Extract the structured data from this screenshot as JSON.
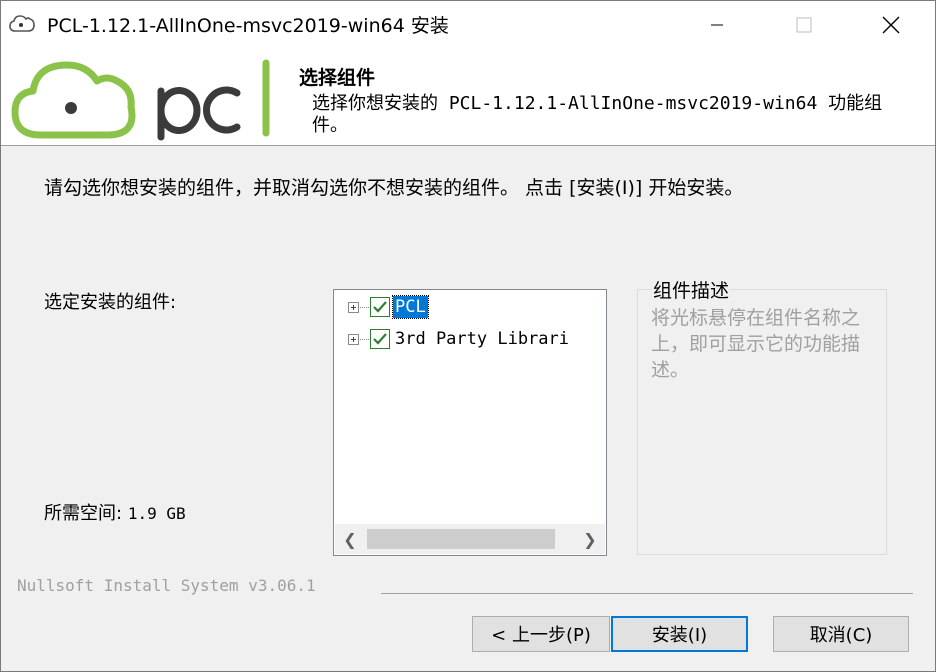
{
  "window": {
    "title": "PCL-1.12.1-AllInOne-msvc2019-win64 安装"
  },
  "header": {
    "title": "选择组件",
    "description": "选择你想安装的 PCL-1.12.1-AllInOne-msvc2019-win64 功能组件。"
  },
  "intro": "请勾选你想安装的组件，并取消勾选你不想安装的组件。 点击 [安装(I)] 开始安装。",
  "components": {
    "label": "选定安装的组件:",
    "items": [
      {
        "label": "PCL",
        "checked": true,
        "selected": true
      },
      {
        "label": "3rd Party Librari",
        "checked": true,
        "selected": false
      }
    ]
  },
  "space": {
    "label": "所需空间:",
    "value": "1.9 GB"
  },
  "description_group": {
    "title": "组件描述",
    "text": "将光标悬停在组件名称之上，即可显示它的功能描述。"
  },
  "footer": {
    "brand": "Nullsoft Install System v3.06.1"
  },
  "buttons": {
    "back": "< 上一步(P)",
    "install": "安装(I)",
    "cancel": "取消(C)"
  },
  "colors": {
    "logo_green": "#8bc34a",
    "logo_dark": "#3b3b3b",
    "selection": "#0078d7",
    "check": "#2e7d32"
  },
  "icons": {
    "app": "installer-icon",
    "minimize": "minimize-icon",
    "maximize": "maximize-icon",
    "close": "close-icon"
  }
}
